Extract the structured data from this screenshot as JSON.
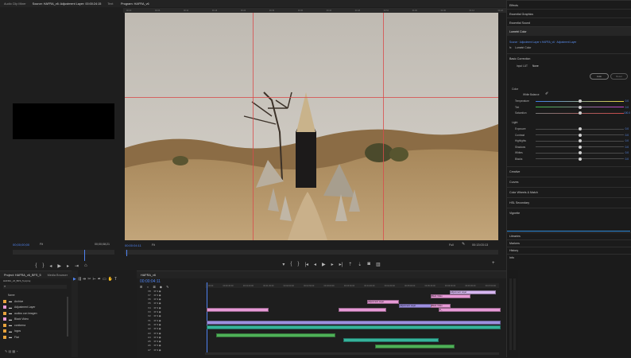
{
  "colors": {
    "accent_blue": "#4f83f1",
    "playhead_red": "#d84b4b",
    "clip_pink": "#e79ad6",
    "clip_purple": "#9d8fe0",
    "clip_teal": "#36b39b",
    "clip_green": "#4fb058",
    "clip_light": "#d6b6f0"
  },
  "source_monitor": {
    "tabs": [
      {
        "label": "Audio Clip Mixer",
        "active": false
      },
      {
        "label": "Source: HAFRA_v6: Adjustment Layer: 00:00:24:15",
        "active": true
      },
      {
        "label": "Text",
        "active": false
      }
    ],
    "timecode": "00;00;00;00",
    "fit": "Fit",
    "duration": "00;00;08;21"
  },
  "program_monitor": {
    "tab_label": "Program: HAFRA_v6",
    "ruler_ticks": [
      "00:00",
      "00:06",
      "00:12",
      "00:18",
      "00:24",
      "00:30",
      "00:36",
      "00:42",
      "00:48",
      "00:54",
      "01:00",
      "01:06",
      "01:12",
      "01:18"
    ],
    "timecode": "00:00:04:11",
    "fit": "Fit",
    "resolution": "Full",
    "duration": "00:13:03:13"
  },
  "project_panel": {
    "tabs": [
      {
        "label": "Project: HAFRA_v6_BFS_5",
        "active": true
      },
      {
        "label": "Media Browser",
        "active": false
      }
    ],
    "path": "HAFRA_v6_BFS_5.prproj",
    "column_name": "Name",
    "items": [
      {
        "label": "Archive",
        "color": "#e7a33c"
      },
      {
        "label": "Adjustment Layer",
        "color": "#e79ad6"
      },
      {
        "label": "audios con imagen",
        "color": "#e7a33c"
      },
      {
        "label": "Black Video",
        "color": "#e79ad6"
      },
      {
        "label": "conforma",
        "color": "#e7a33c"
      },
      {
        "label": "logos",
        "color": "#e7a33c"
      },
      {
        "label": "Flat",
        "color": "#e7a33c"
      }
    ]
  },
  "timeline": {
    "tab_label": "HAFRA_v6",
    "timecode": "00:00:04:11",
    "ruler_ticks": [
      "00:00",
      "00:00:30:00",
      "00:01:00:00",
      "00:01:30:00",
      "00:02:00:00",
      "00:02:30:00",
      "00:03:00:00",
      "00:03:30:00",
      "00:04:00:00",
      "00:04:30:00",
      "00:05:00:00",
      "00:05:30:00",
      "00:06:00:00",
      "00:06:30:00",
      "00:07:00:00"
    ],
    "video_tracks": [
      "V8",
      "V7",
      "V6",
      "V5",
      "V4",
      "V3",
      "V2",
      "V1"
    ],
    "audio_tracks": [
      "A1",
      "A2",
      "A3",
      "A4",
      "A5",
      "A6",
      "A7"
    ],
    "clip_labels": [
      "Adjustment Layer",
      "Black Video",
      "Adjustment Layer",
      "Adjustment Layer",
      "Black Video",
      "fx_"
    ]
  },
  "effects_panel": {
    "sections": [
      "Effects",
      "Essential Graphics",
      "Essential Sound",
      "Lumetri Color"
    ],
    "source_line": "Source · Adjustment Layer  ▾  HAFRA_v6 · Adjustment Layer",
    "fx_name": "Lumetri Color",
    "basic_correction": "Basic Correction",
    "input_lut_label": "Input LUT",
    "input_lut_value": "None",
    "auto_label": "Auto",
    "reset_label": "Reset",
    "color_header": "Color",
    "white_balance": "White Balance",
    "color_rows": [
      {
        "label": "Temperature",
        "value": "0.0",
        "pos": 0.5
      },
      {
        "label": "Tint",
        "value": "0.0",
        "pos": 0.5
      },
      {
        "label": "Saturation",
        "value": "100.0",
        "pos": 0.5
      }
    ],
    "light_header": "Light",
    "light_rows": [
      {
        "label": "Exposure",
        "value": "0.0",
        "pos": 0.5
      },
      {
        "label": "Contrast",
        "value": "0.0",
        "pos": 0.5
      },
      {
        "label": "Highlights",
        "value": "0.0",
        "pos": 0.5
      },
      {
        "label": "Shadows",
        "value": "0.0",
        "pos": 0.5
      },
      {
        "label": "Whites",
        "value": "0.0",
        "pos": 0.5
      },
      {
        "label": "Blacks",
        "value": "0.0",
        "pos": 0.5
      }
    ],
    "collapsed_sections": [
      "Creative",
      "Curves",
      "Color Wheels & Match",
      "HSL Secondary",
      "Vignette"
    ],
    "bottom_sections": [
      "Libraries",
      "Markers",
      "History",
      "Info"
    ]
  }
}
